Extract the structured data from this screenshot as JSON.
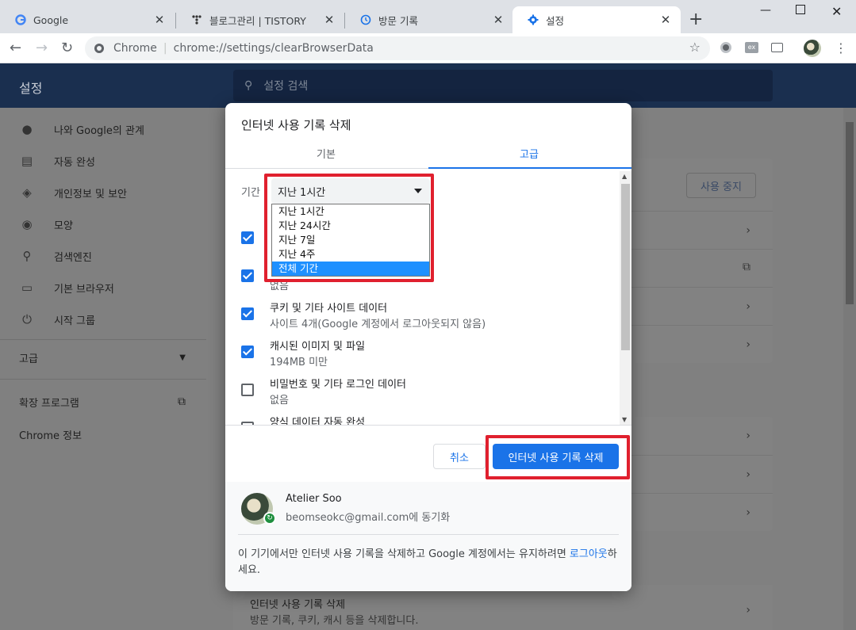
{
  "tabs": [
    {
      "title": "Google",
      "icon": "google-icon"
    },
    {
      "title": "블로그관리 | TISTORY",
      "icon": "tistory-icon"
    },
    {
      "title": "방문 기록",
      "icon": "history-icon"
    },
    {
      "title": "설정",
      "icon": "settings-gear-icon"
    }
  ],
  "omnibox": {
    "scheme": "Chrome",
    "url": "chrome://settings/clearBrowserData"
  },
  "settings_page": {
    "title": "설정",
    "search_placeholder": "설정 검색",
    "sidebar": [
      {
        "label": "나와 Google의 관계",
        "icon": "person-icon"
      },
      {
        "label": "자동 완성",
        "icon": "clipboard-icon"
      },
      {
        "label": "개인정보 및 보안",
        "icon": "shield-icon"
      },
      {
        "label": "모양",
        "icon": "palette-icon"
      },
      {
        "label": "검색엔진",
        "icon": "search-icon"
      },
      {
        "label": "기본 브라우저",
        "icon": "browser-icon"
      },
      {
        "label": "시작 그룹",
        "icon": "power-icon"
      }
    ],
    "advanced_label": "고급",
    "extensions_label": "확장 프로그램",
    "about_label": "Chrome 정보",
    "sync_stop_button": "사용 중지",
    "bottom_row": {
      "title": "인터넷 사용 기록 삭제",
      "subtitle": "방문 기록, 쿠키, 캐시 등을 삭제합니다."
    }
  },
  "dialog": {
    "title": "인터넷 사용 기록 삭제",
    "tab_basic": "기본",
    "tab_advanced": "고급",
    "period_label": "기간",
    "period_selected": "지난 1시간",
    "period_options": [
      "지난 1시간",
      "지난 24시간",
      "지난 7일",
      "지난 4주",
      "전체 기간"
    ],
    "items": [
      {
        "title": "",
        "sub": "",
        "checked": true
      },
      {
        "title": "",
        "sub": "없음",
        "checked": true
      },
      {
        "title": "쿠키 및 기타 사이트 데이터",
        "sub": "사이트 4개(Google 계정에서 로그아웃되지 않음)",
        "checked": true
      },
      {
        "title": "캐시된 이미지 및 파일",
        "sub": "194MB 미만",
        "checked": true
      },
      {
        "title": "비밀번호 및 기타 로그인 데이터",
        "sub": "없음",
        "checked": false
      },
      {
        "title": "양식 데이터 자동 완성",
        "sub": "",
        "checked": false
      }
    ],
    "cancel_label": "취소",
    "delete_label": "인터넷 사용 기록 삭제",
    "user_name": "Atelier Soo",
    "user_email_sync": "beomseokc@gmail.com에 동기화",
    "footer_text": "이 기기에서만 인터넷 사용 기록을 삭제하고 Google 계정에서는 유지하려면 ",
    "footer_link": "로그아웃",
    "footer_end": "하세요."
  },
  "colors": {
    "accent": "#1a73e8",
    "highlight": "#e0202e",
    "header": "#1a2f4f"
  }
}
